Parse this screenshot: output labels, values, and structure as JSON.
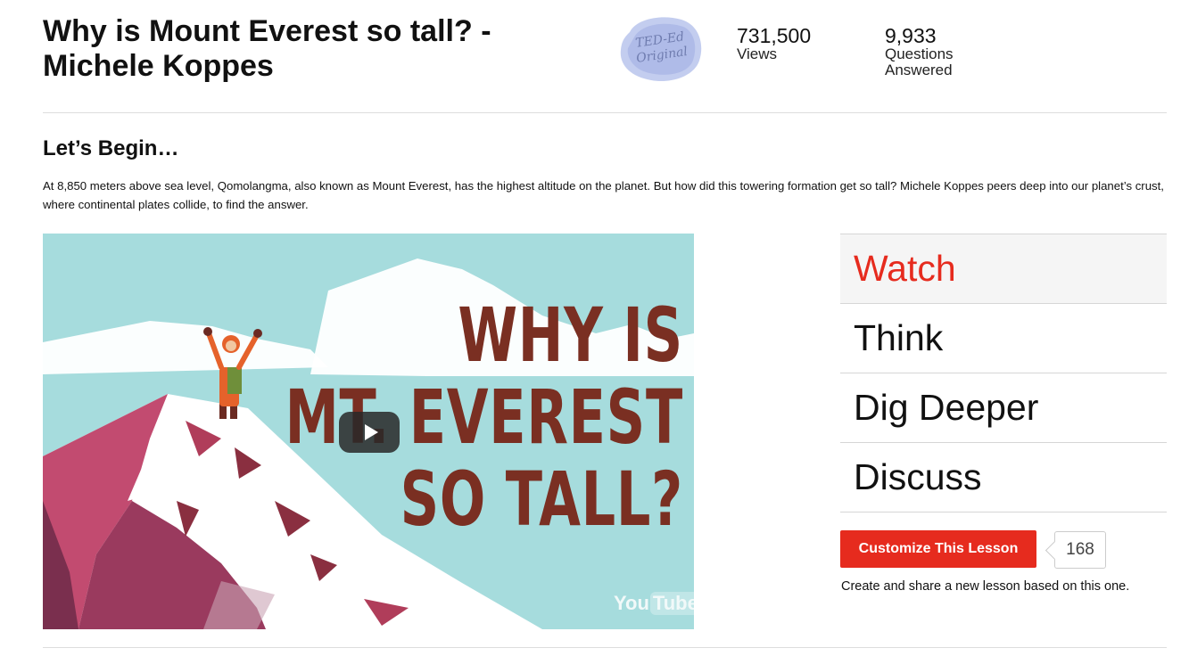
{
  "lesson": {
    "title": "Why is Mount Everest so tall? - Michele Koppes",
    "badge": {
      "line1": "TED-Ed",
      "line2": "Original"
    }
  },
  "stats": {
    "views": {
      "value": "731,500",
      "label": "Views"
    },
    "answered": {
      "value": "9,933",
      "label_line1": "Questions",
      "label_line2": "Answered"
    }
  },
  "intro": {
    "heading": "Let’s Begin…",
    "description": "At 8,850 meters above sea level, Qomolangma, also known as Mount Everest, has the highest altitude on the planet. But how did this towering formation get so tall? Michele Koppes peers deep into our planet’s crust, where continental plates collide, to find the answer."
  },
  "video": {
    "title_lines": [
      "WHY IS",
      "MT. EVEREST",
      "SO TALL?"
    ],
    "player_logo": {
      "you": "You",
      "tube": "Tube"
    }
  },
  "nav": {
    "items": [
      {
        "label": "Watch",
        "active": true
      },
      {
        "label": "Think",
        "active": false
      },
      {
        "label": "Dig Deeper",
        "active": false
      },
      {
        "label": "Discuss",
        "active": false
      }
    ]
  },
  "customize": {
    "button_label": "Customize This Lesson",
    "count": "168",
    "note": "Create and share a new lesson based on this one."
  },
  "colors": {
    "accent": "#e62b1e",
    "video_sky": "#a6dcdd",
    "video_title": "#7a2f22"
  }
}
